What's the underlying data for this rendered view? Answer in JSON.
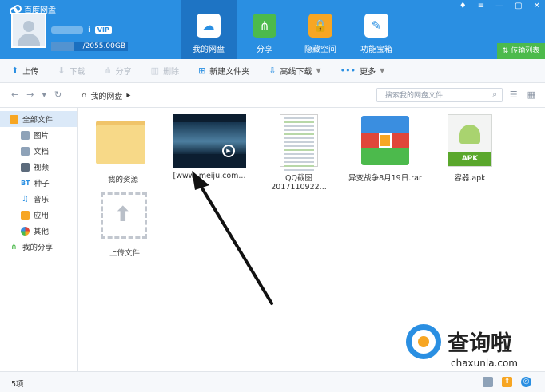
{
  "app": {
    "title": "百度网盘"
  },
  "user": {
    "name_suffix": "i",
    "vip": "VIP",
    "quota_text": "/2055.00GB",
    "quota_used_fraction": 0.3
  },
  "nav": [
    {
      "label": "我的网盘",
      "icon": "cloud-icon"
    },
    {
      "label": "分享",
      "icon": "share-icon"
    },
    {
      "label": "隐藏空间",
      "icon": "lock-icon"
    },
    {
      "label": "功能宝箱",
      "icon": "toolbox-icon"
    }
  ],
  "transfer_label": "传输列表",
  "toolbar": {
    "upload": "上传",
    "download": "下载",
    "share": "分享",
    "delete": "删除",
    "new_folder": "新建文件夹",
    "offline_download": "高线下载",
    "more": "更多"
  },
  "address": {
    "path": "我的网盘",
    "search_placeholder": "搜索我的网盘文件"
  },
  "sidebar": {
    "all_files": "全部文件",
    "categories": [
      "图片",
      "文档",
      "视频",
      "种子",
      "音乐",
      "应用",
      "其他"
    ],
    "my_share": "我的分享"
  },
  "files": [
    {
      "name": "我的资源",
      "type": "folder"
    },
    {
      "name": "[www.        meiju.com...",
      "type": "video"
    },
    {
      "name": "QQ截图2017110922...",
      "type": "image"
    },
    {
      "name": "异变战争8月19日.rar",
      "type": "rar"
    },
    {
      "name": "容器.apk",
      "type": "apk",
      "badge": "APK"
    },
    {
      "name": "上传文件",
      "type": "upload"
    }
  ],
  "status": {
    "count": "5项"
  },
  "watermark": {
    "text": "查询啦",
    "url": "chaxunla.com"
  },
  "colors": {
    "brand": "#2a8fe2",
    "active_nav": "#1e74c4",
    "green": "#4cba4c"
  }
}
